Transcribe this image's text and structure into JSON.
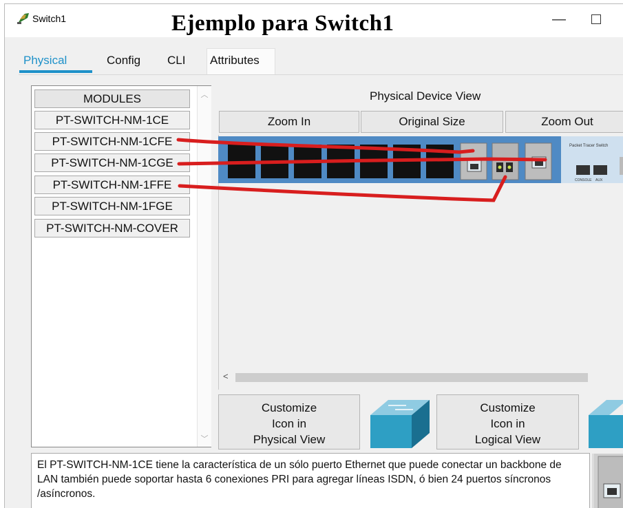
{
  "window": {
    "title": "Switch1",
    "headline": "Ejemplo para Switch1",
    "minimize_glyph": "—"
  },
  "tabs": [
    {
      "label": "Physical",
      "active": true
    },
    {
      "label": "Config",
      "active": false
    },
    {
      "label": "CLI",
      "active": false
    },
    {
      "label": "Attributes",
      "active": false
    }
  ],
  "modules": {
    "header": "MODULES",
    "items": [
      "PT-SWITCH-NM-1CE",
      "PT-SWITCH-NM-1CFE",
      "PT-SWITCH-NM-1CGE",
      "PT-SWITCH-NM-1FFE",
      "PT-SWITCH-NM-1FGE",
      "PT-SWITCH-NM-COVER"
    ]
  },
  "physical_view": {
    "label": "Physical Device View",
    "zoom_in": "Zoom In",
    "original_size": "Original Size",
    "zoom_out": "Zoom Out",
    "device_label": "Packet Tracer Switch",
    "port_labels": [
      "CONSOLE",
      "AUX"
    ]
  },
  "customize": {
    "physical": [
      "Customize",
      "Icon in",
      "Physical View"
    ],
    "logical": [
      "Customize",
      "Icon in",
      "Logical View"
    ]
  },
  "description": "El PT-SWITCH-NM-1CE tiene la característica de un sólo puerto Ethernet que puede conectar un backbone de LAN también puede soportar hasta 6 conexiones PRI para agregar líneas ISDN, ó bien 24 puertos síncronos /asíncronos.",
  "colors": {
    "accent": "#1e91c9",
    "annotation": "#d81e1e",
    "switch_chassis": "#4f8ac4",
    "switch_icon": "#2e9fc4"
  },
  "icons": [
    "switch-app-icon",
    "scroll-up-icon",
    "scroll-down-icon",
    "scroll-left-icon",
    "switch-physical-icon",
    "switch-logical-icon"
  ]
}
